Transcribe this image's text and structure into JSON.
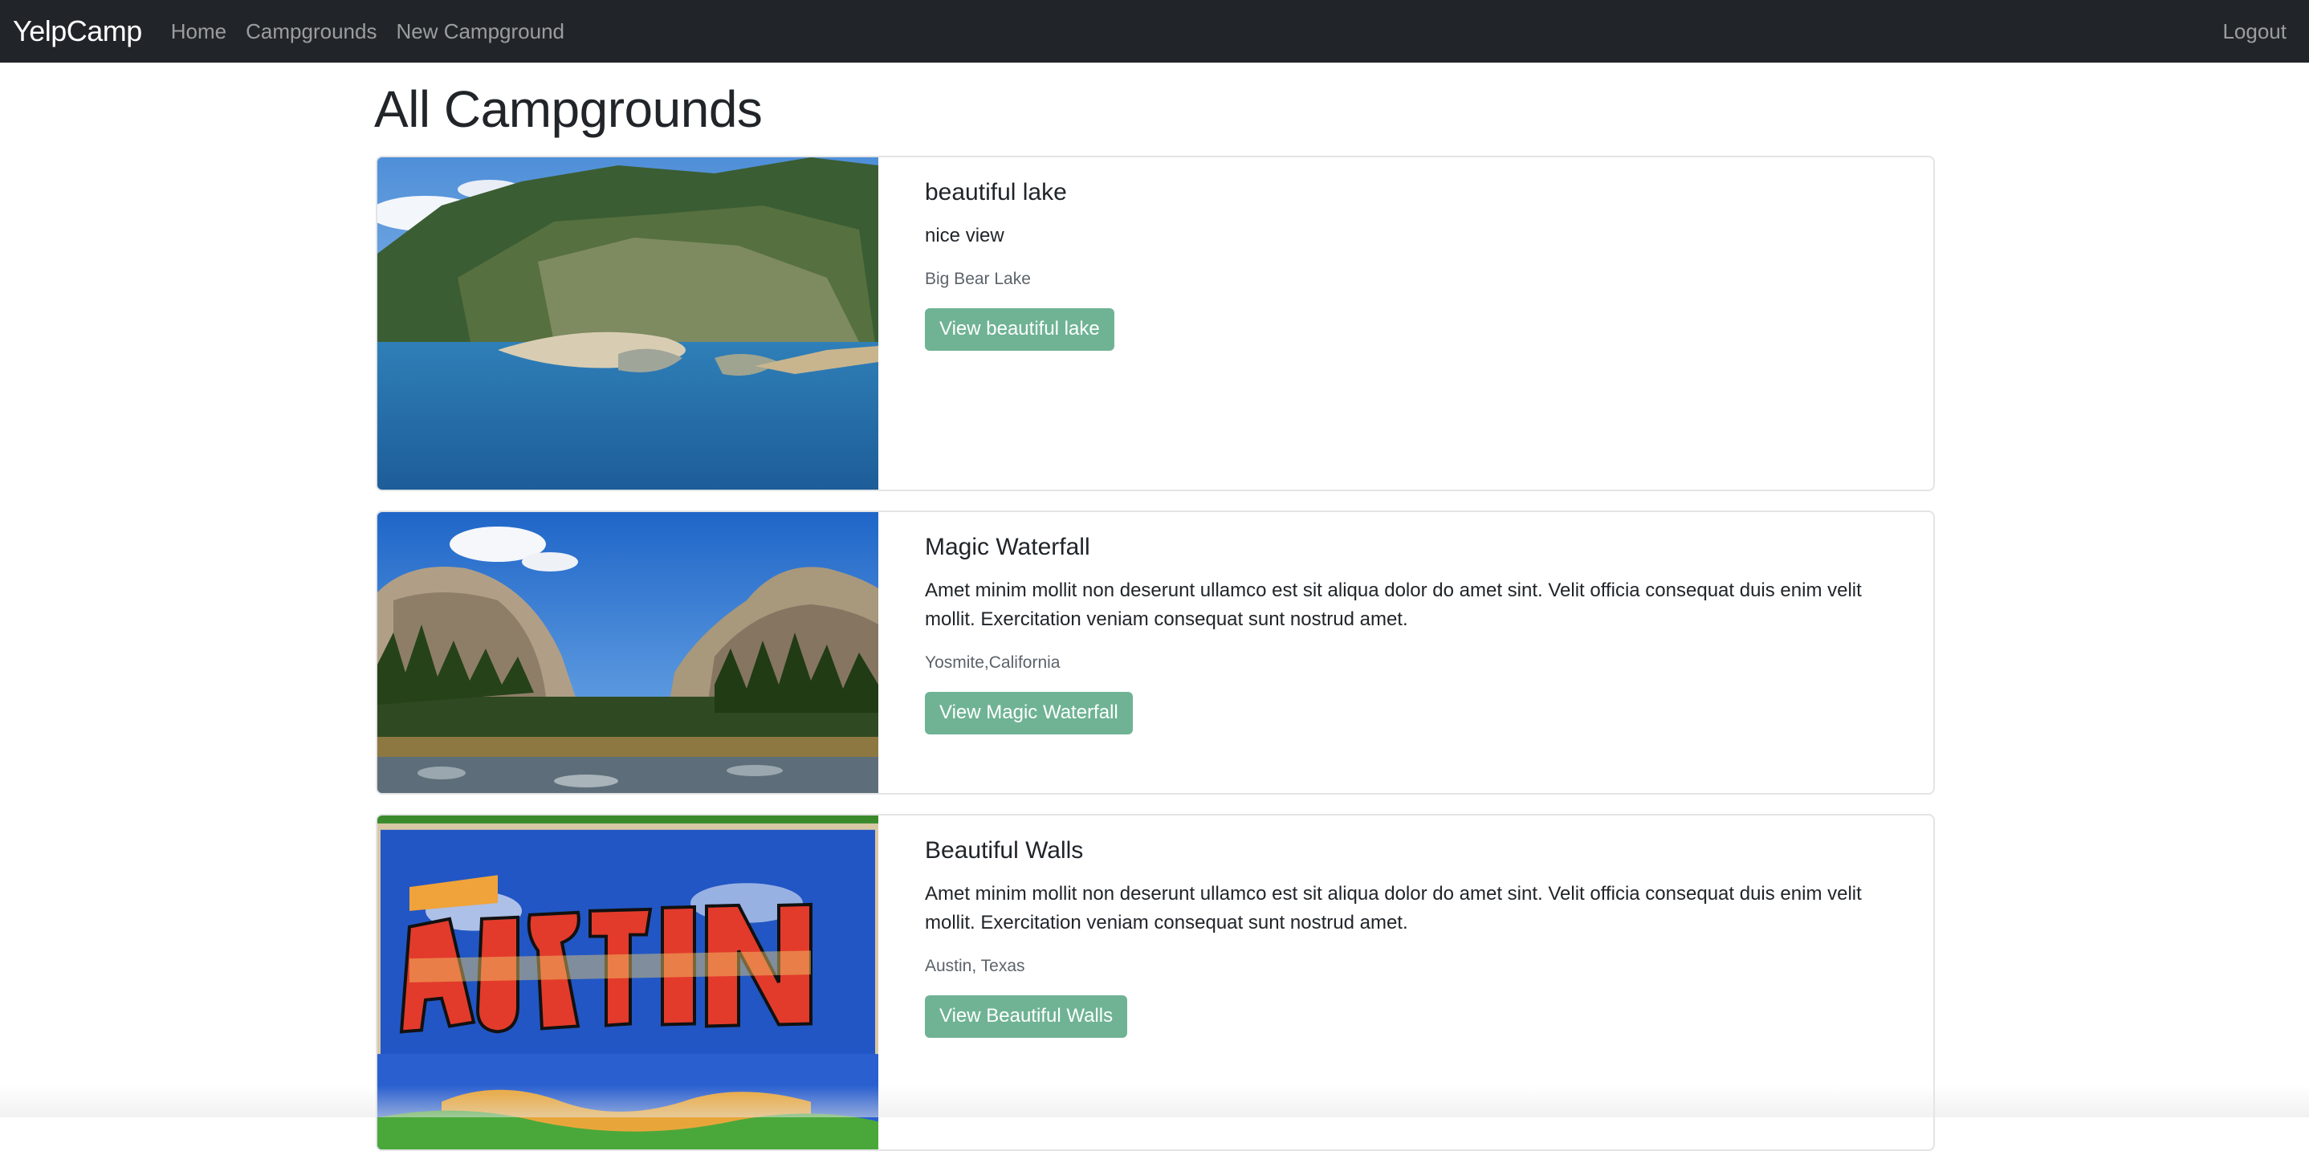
{
  "navbar": {
    "brand": "YelpCamp",
    "links": [
      {
        "label": "Home"
      },
      {
        "label": "Campgrounds"
      },
      {
        "label": "New Campground"
      }
    ],
    "logout": "Logout",
    "background": "#212529"
  },
  "page": {
    "title": "All Campgrounds"
  },
  "campgrounds": [
    {
      "title": "beautiful lake",
      "description": "nice view",
      "location": "Big Bear Lake",
      "button": "View beautiful lake",
      "image_icon": "lake-photo"
    },
    {
      "title": "Magic Waterfall",
      "description": "Amet minim mollit non deserunt ullamco est sit aliqua dolor do amet sint. Velit officia consequat duis enim velit mollit. Exercitation veniam consequat sunt nostrud amet.",
      "location": "Yosmite,California",
      "button": "View Magic Waterfall",
      "image_icon": "valley-photo"
    },
    {
      "title": "Beautiful Walls",
      "description": "Amet minim mollit non deserunt ullamco est sit aliqua dolor do amet sint. Velit officia consequat duis enim velit mollit. Exercitation veniam consequat sunt nostrud amet.",
      "location": "Austin, Texas",
      "button": "View Beautiful Walls",
      "image_icon": "mural-photo"
    }
  ],
  "colors": {
    "button": "#6fb394",
    "card_border": "#e3e4e6"
  }
}
